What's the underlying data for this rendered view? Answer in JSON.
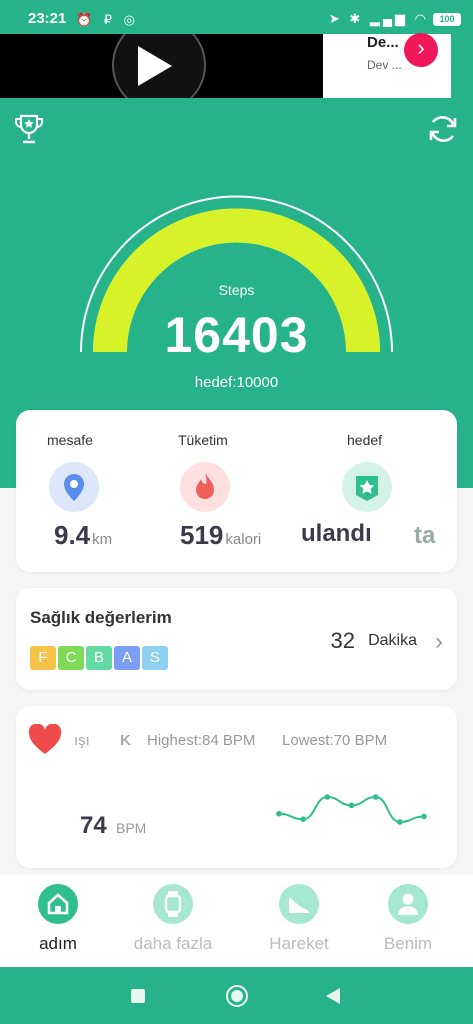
{
  "status_bar": {
    "time": "23:21",
    "battery": "100"
  },
  "ad": {
    "title": "De...",
    "subtitle": "Dev ..."
  },
  "steps": {
    "label": "Steps",
    "value": "16403",
    "goal_text": "hedef:10000",
    "progress": 1.0
  },
  "stats": [
    {
      "label": "mesafe",
      "value": "9.4",
      "unit": "km",
      "icon": "location-pin-icon",
      "color": "#5b8def"
    },
    {
      "label": "Tüketim",
      "value": "519",
      "unit": "kalori",
      "icon": "flame-icon",
      "color": "#f0605a"
    },
    {
      "label": "hedef",
      "value": "ulandı",
      "unit": "ta",
      "icon": "star-badge-icon",
      "color": "#2fbf8f"
    }
  ],
  "health": {
    "title": "Sağlık değerlerim",
    "grades": [
      "F",
      "C",
      "B",
      "A",
      "S"
    ],
    "grade_colors": [
      "#f5c24a",
      "#7ed957",
      "#63d9a3",
      "#7a9ff5",
      "#8ed0f0"
    ],
    "duration_value": "32",
    "duration_unit": "Dakika"
  },
  "heart_rate": {
    "tab_partial": "ışı",
    "tab_partial2": "K",
    "highest": "Highest:84",
    "highest_unit": "BPM",
    "lowest": "Lowest:70",
    "lowest_unit": "BPM",
    "current_value": "74",
    "current_unit": "BPM",
    "trend": [
      74,
      72,
      80,
      77,
      80,
      71,
      73
    ]
  },
  "nav": [
    {
      "label": "adım",
      "icon": "home-icon",
      "active": true
    },
    {
      "label": "daha fazla",
      "icon": "watch-icon",
      "active": false
    },
    {
      "label": "Hareket",
      "icon": "shoe-icon",
      "active": false
    },
    {
      "label": "Benim",
      "icon": "user-icon",
      "active": false
    }
  ],
  "colors": {
    "brand": "#26b389",
    "gauge": "#d8f22a",
    "heart": "#ef4b4b"
  }
}
